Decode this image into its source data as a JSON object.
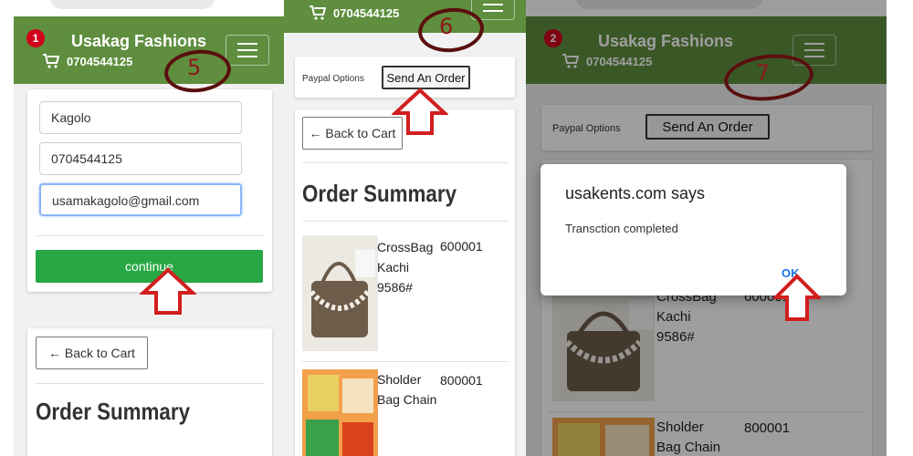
{
  "brand": "Usakag Fashions",
  "phone": "0704544125",
  "colors": {
    "header_green": "#5e8e3e",
    "continue_green": "#28a745",
    "badge_red": "#d0021b",
    "annotation_red": "#d21e1e",
    "ok_blue": "#1a73e8"
  },
  "steps": [
    "5",
    "6",
    "7"
  ],
  "panel1": {
    "cart_count": "1",
    "form": {
      "name_value": "Kagolo",
      "phone_value": "0704544125",
      "email_value": "usamakagolo@gmail.com"
    },
    "continue_label": "continue",
    "back_to_cart_label": "← Back to Cart",
    "order_summary_title": "Order Summary"
  },
  "panel2": {
    "paypal_options_label": "Paypal Options",
    "send_order_label": "Send An Order",
    "back_to_cart_label": "← Back to Cart",
    "order_summary_title": "Order Summary",
    "products": [
      {
        "name_lines": [
          "CrossBag",
          "Kachi",
          "9586#"
        ],
        "code": "600001",
        "image_icon": "handbag-photo"
      },
      {
        "name_lines": [
          "Sholder",
          "Bag Chain"
        ],
        "code": "800001",
        "image_icon": "bag-chain-photo"
      }
    ]
  },
  "panel3": {
    "cart_count": "2",
    "paypal_options_label": "Paypal Options",
    "send_order_label": "Send An Order",
    "dialog": {
      "title": "usakents.com says",
      "message": "Transction completed",
      "ok_label": "OK"
    },
    "products": [
      {
        "name_lines": [
          "CrossBag",
          "Kachi",
          "9586#"
        ],
        "code": "600001",
        "image_icon": "handbag-photo"
      },
      {
        "name_lines": [
          "Sholder",
          "Bag Chain"
        ],
        "code": "800001",
        "image_icon": "bag-chain-photo"
      }
    ]
  }
}
